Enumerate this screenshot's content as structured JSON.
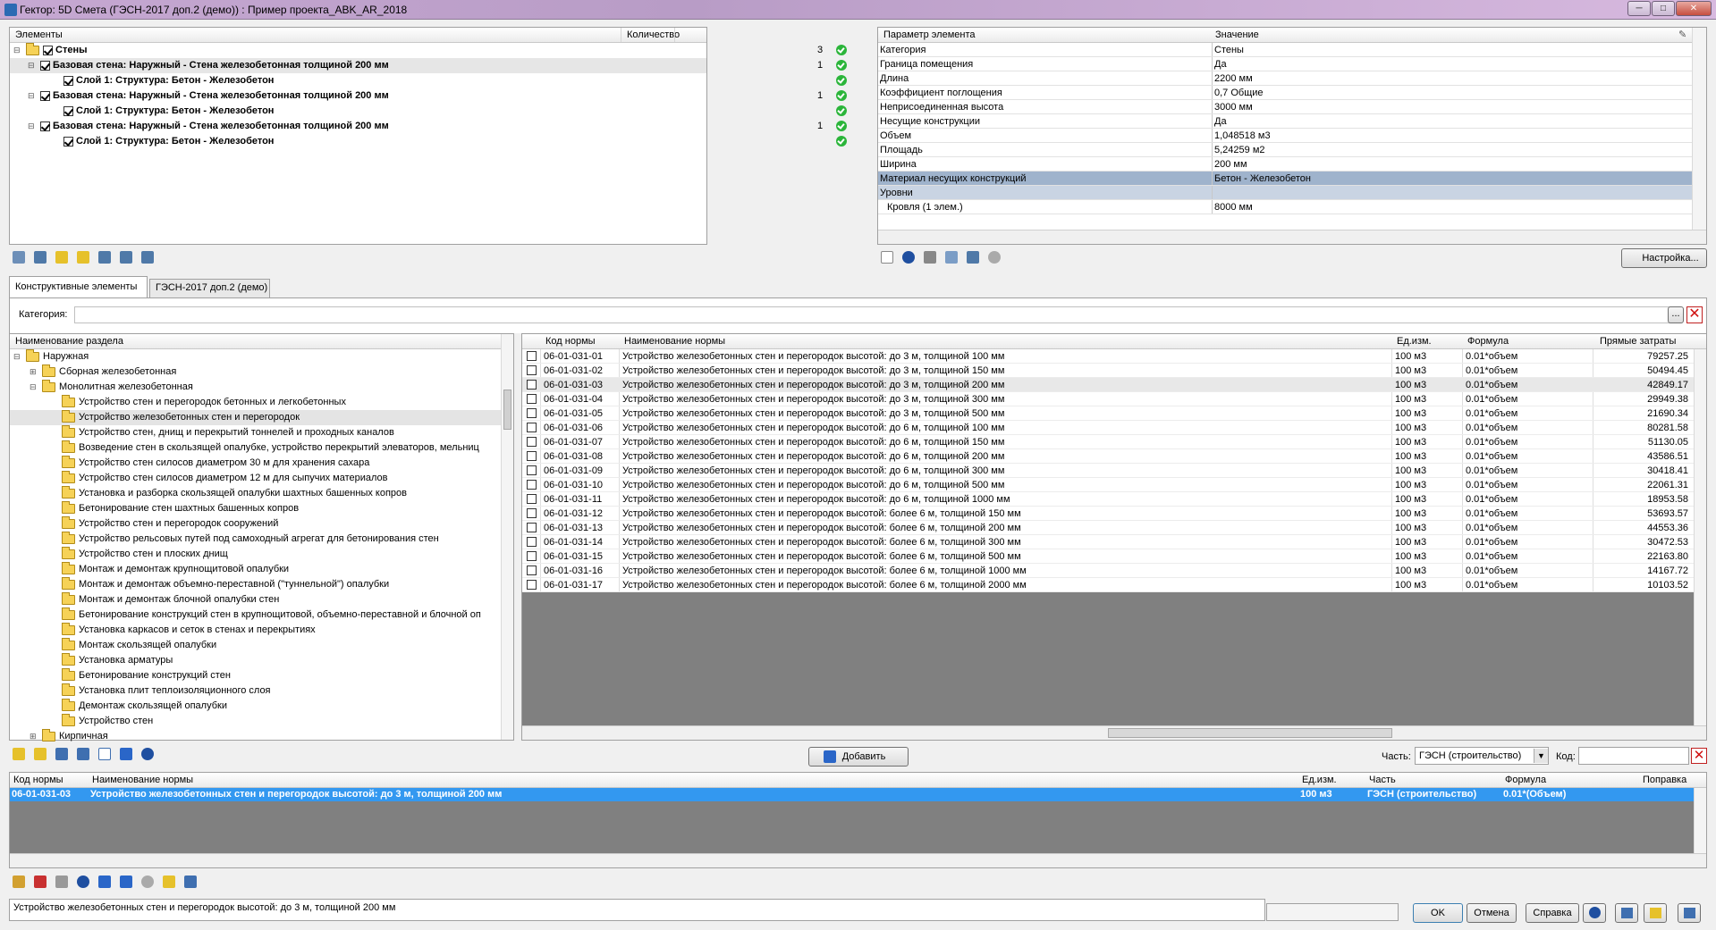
{
  "window": {
    "title": "Гектор: 5D Смета (ГЭСН-2017 доп.2 (демо)) : Пример проекта_ABK_AR_2018",
    "minimize": "─",
    "maximize": "□",
    "close": "✕"
  },
  "elements_panel": {
    "col_elements": "Элементы",
    "col_quantity": "Количество",
    "rows": [
      {
        "label": "Стены",
        "qty": "3",
        "level": 0
      },
      {
        "label": "Базовая стена: Наружный - Стена железобетонная толщиной 200 мм",
        "qty": "1",
        "level": 1
      },
      {
        "label": "Слой 1: Структура: Бетон - Железобетон",
        "qty": "",
        "level": 2
      },
      {
        "label": "Базовая стена: Наружный - Стена железобетонная толщиной 200 мм",
        "qty": "1",
        "level": 1
      },
      {
        "label": "Слой 1: Структура: Бетон - Железобетон",
        "qty": "",
        "level": 2
      },
      {
        "label": "Базовая стена: Наружный - Стена железобетонная толщиной 200 мм",
        "qty": "1",
        "level": 1
      },
      {
        "label": "Слой 1: Структура: Бетон - Железобетон",
        "qty": "",
        "level": 2
      }
    ]
  },
  "params_panel": {
    "col_param": "Параметр элемента",
    "col_value": "Значение",
    "rows": [
      {
        "p": "Категория",
        "v": "Стены"
      },
      {
        "p": "Граница помещения",
        "v": "Да"
      },
      {
        "p": "Длина",
        "v": "2200 мм"
      },
      {
        "p": "Коэффициент поглощения",
        "v": "0,7 Общие"
      },
      {
        "p": "Неприсоединенная высота",
        "v": "3000 мм"
      },
      {
        "p": "Несущие конструкции",
        "v": "Да"
      },
      {
        "p": "Объем",
        "v": "1,048518 м3"
      },
      {
        "p": "Площадь",
        "v": "5,24259 м2"
      },
      {
        "p": "Ширина",
        "v": "200 мм"
      },
      {
        "p": "Материал несущих конструкций",
        "v": "Бетон - Железобетон"
      },
      {
        "p": "Уровни",
        "v": ""
      },
      {
        "p": "Кровля (1 элем.)",
        "v": "8000 мм"
      }
    ]
  },
  "settings_button": "Настройка...",
  "tabs": {
    "t1": "Конструктивные элементы",
    "t2": "ГЭСН-2017 доп.2 (демо)"
  },
  "category_label": "Категория:",
  "category_browse": "...",
  "sections": {
    "header": "Наименование раздела",
    "items": [
      {
        "label": "Наружная",
        "level": 0
      },
      {
        "label": "Сборная железобетонная",
        "level": 1
      },
      {
        "label": "Монолитная железобетонная",
        "level": 1
      },
      {
        "label": "Устройство стен и перегородок бетонных и легкобетонных",
        "level": 2
      },
      {
        "label": "Устройство железобетонных стен и перегородок",
        "level": 2
      },
      {
        "label": "Устройство стен, днищ и перекрытий тоннелей и проходных каналов",
        "level": 2
      },
      {
        "label": "Возведение стен в скользящей опалубке, устройство перекрытий элеваторов, мельниц",
        "level": 2
      },
      {
        "label": "Устройство стен силосов диаметром 30 м для хранения сахара",
        "level": 2
      },
      {
        "label": "Устройство стен силосов диаметром 12 м для сыпучих материалов",
        "level": 2
      },
      {
        "label": "Установка и разборка скользящей опалубки шахтных башенных копров",
        "level": 2
      },
      {
        "label": "Бетонирование стен шахтных башенных копров",
        "level": 2
      },
      {
        "label": "Устройство стен и перегородок сооружений",
        "level": 2
      },
      {
        "label": "Устройство рельсовых путей под самоходный агрегат для бетонирования стен",
        "level": 2
      },
      {
        "label": "Устройство стен и плоских днищ",
        "level": 2
      },
      {
        "label": "Монтаж и демонтаж крупнощитовой опалубки",
        "level": 2
      },
      {
        "label": "Монтаж и демонтаж объемно-переставной (\"туннельной\") опалубки",
        "level": 2
      },
      {
        "label": "Монтаж и демонтаж блочной опалубки стен",
        "level": 2
      },
      {
        "label": "Бетонирование конструкций стен в крупнощитовой, объемно-переставной и блочной оп",
        "level": 2
      },
      {
        "label": "Установка каркасов и сеток в стенах и перекрытиях",
        "level": 2
      },
      {
        "label": "Монтаж скользящей опалубки",
        "level": 2
      },
      {
        "label": "Установка арматуры",
        "level": 2
      },
      {
        "label": "Бетонирование конструкций стен",
        "level": 2
      },
      {
        "label": "Установка плит теплоизоляционного слоя",
        "level": 2
      },
      {
        "label": "Демонтаж скользящей опалубки",
        "level": 2
      },
      {
        "label": "Устройство стен",
        "level": 2
      },
      {
        "label": "Кирпичная",
        "level": 1
      }
    ]
  },
  "norms": {
    "headers": {
      "code": "Код нормы",
      "name": "Наименование нормы",
      "unit": "Ед.изм.",
      "formula": "Формула",
      "cost": "Прямые затраты"
    },
    "rows": [
      [
        "06-01-031-01",
        "Устройство железобетонных стен и перегородок высотой: до 3 м, толщиной 100 мм",
        "100 м3",
        "0.01*объем",
        "79257.25"
      ],
      [
        "06-01-031-02",
        "Устройство железобетонных стен и перегородок высотой: до 3 м, толщиной 150 мм",
        "100 м3",
        "0.01*объем",
        "50494.45"
      ],
      [
        "06-01-031-03",
        "Устройство железобетонных стен и перегородок высотой: до 3 м, толщиной 200 мм",
        "100 м3",
        "0.01*объем",
        "42849.17"
      ],
      [
        "06-01-031-04",
        "Устройство железобетонных стен и перегородок высотой: до 3 м, толщиной 300 мм",
        "100 м3",
        "0.01*объем",
        "29949.38"
      ],
      [
        "06-01-031-05",
        "Устройство железобетонных стен и перегородок высотой: до 3 м, толщиной 500 мм",
        "100 м3",
        "0.01*объем",
        "21690.34"
      ],
      [
        "06-01-031-06",
        "Устройство железобетонных стен и перегородок высотой: до 6 м, толщиной 100 мм",
        "100 м3",
        "0.01*объем",
        "80281.58"
      ],
      [
        "06-01-031-07",
        "Устройство железобетонных стен и перегородок высотой: до 6 м, толщиной 150 мм",
        "100 м3",
        "0.01*объем",
        "51130.05"
      ],
      [
        "06-01-031-08",
        "Устройство железобетонных стен и перегородок высотой: до 6 м, толщиной 200 мм",
        "100 м3",
        "0.01*объем",
        "43586.51"
      ],
      [
        "06-01-031-09",
        "Устройство железобетонных стен и перегородок высотой: до 6 м, толщиной 300 мм",
        "100 м3",
        "0.01*объем",
        "30418.41"
      ],
      [
        "06-01-031-10",
        "Устройство железобетонных стен и перегородок высотой: до 6 м, толщиной 500 мм",
        "100 м3",
        "0.01*объем",
        "22061.31"
      ],
      [
        "06-01-031-11",
        "Устройство железобетонных стен и перегородок высотой: до 6 м, толщиной 1000 мм",
        "100 м3",
        "0.01*объем",
        "18953.58"
      ],
      [
        "06-01-031-12",
        "Устройство железобетонных стен и перегородок высотой: более 6 м, толщиной 150 мм",
        "100 м3",
        "0.01*объем",
        "53693.57"
      ],
      [
        "06-01-031-13",
        "Устройство железобетонных стен и перегородок высотой: более 6 м, толщиной 200 мм",
        "100 м3",
        "0.01*объем",
        "44553.36"
      ],
      [
        "06-01-031-14",
        "Устройство железобетонных стен и перегородок высотой: более 6 м, толщиной 300 мм",
        "100 м3",
        "0.01*объем",
        "30472.53"
      ],
      [
        "06-01-031-15",
        "Устройство железобетонных стен и перегородок высотой: более 6 м, толщиной 500 мм",
        "100 м3",
        "0.01*объем",
        "22163.80"
      ],
      [
        "06-01-031-16",
        "Устройство железобетонных стен и перегородок высотой: более 6 м, толщиной 1000 мм",
        "100 м3",
        "0.01*объем",
        "14167.72"
      ],
      [
        "06-01-031-17",
        "Устройство железобетонных стен и перегородок высотой: более 6 м, толщиной 2000 мм",
        "100 м3",
        "0.01*объем",
        "10103.52"
      ]
    ]
  },
  "add_button": "Добавить",
  "part_label": "Часть:",
  "part_value": "ГЭСН (строительство)",
  "code_label": "Код:",
  "code_value": "",
  "selected": {
    "headers": {
      "code": "Код нормы",
      "name": "Наименование нормы",
      "unit": "Ед.изм.",
      "part": "Часть",
      "formula": "Формула",
      "fix": "Поправка"
    },
    "rows": [
      {
        "code": "06-01-031-03",
        "name": "Устройство железобетонных стен и перегородок высотой: до 3 м, толщиной 200 мм",
        "unit": "100 м3",
        "part": "ГЭСН (строительство)",
        "formula": "0.01*(Объем)",
        "fix": ""
      }
    ]
  },
  "status_text": "Устройство железобетонных стен и перегородок высотой: до 3 м, толщиной 200 мм",
  "buttons": {
    "ok": "OK",
    "cancel": "Отмена",
    "help": "Справка"
  }
}
